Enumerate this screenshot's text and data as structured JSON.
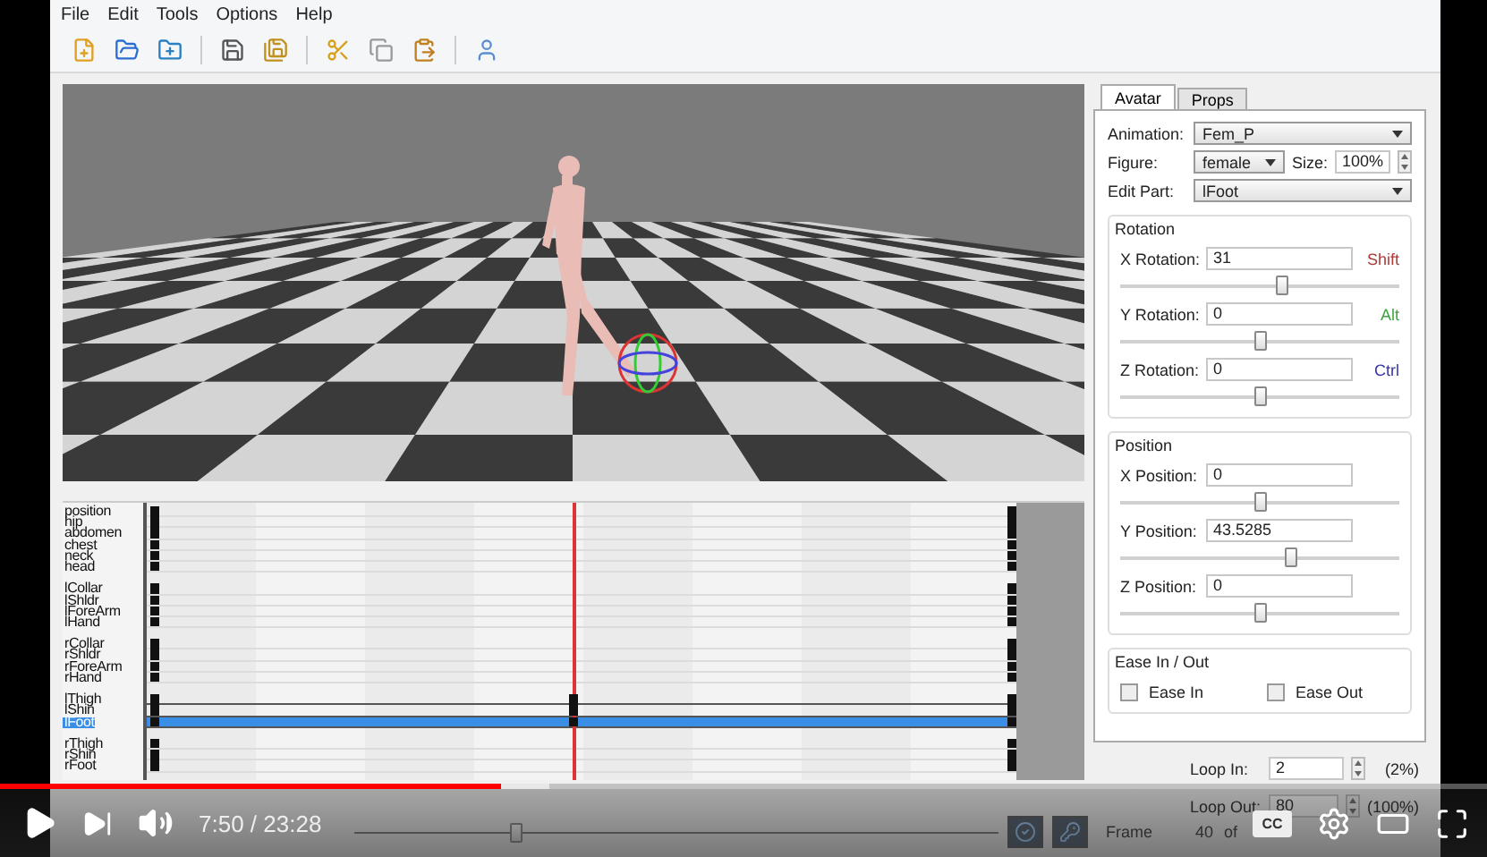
{
  "menu": [
    "File",
    "Edit",
    "Tools",
    "Options",
    "Help"
  ],
  "viewport": {
    "kind": "scene"
  },
  "timeline": {
    "playhead": {
      "level": 0.49
    },
    "groups": [
      {
        "tracks": [
          {
            "name": "position",
            "selected": false,
            "keyed": false
          },
          {
            "name": "hip",
            "selected": false,
            "keyed": false
          },
          {
            "name": "abdomen",
            "selected": false,
            "keyed": false
          },
          {
            "name": "chest",
            "selected": false,
            "keyed": false
          },
          {
            "name": "neck",
            "selected": false,
            "keyed": false
          },
          {
            "name": "head",
            "selected": false,
            "keyed": false
          }
        ]
      },
      {
        "tracks": [
          {
            "name": "lCollar",
            "selected": false,
            "keyed": false
          },
          {
            "name": "lShldr",
            "selected": false,
            "keyed": false
          },
          {
            "name": "lForeArm",
            "selected": false,
            "keyed": false
          },
          {
            "name": "lHand",
            "selected": false,
            "keyed": false
          }
        ]
      },
      {
        "tracks": [
          {
            "name": "rCollar",
            "selected": false,
            "keyed": false
          },
          {
            "name": "rShldr",
            "selected": false,
            "keyed": false
          },
          {
            "name": "rForeArm",
            "selected": false,
            "keyed": false
          },
          {
            "name": "rHand",
            "selected": false,
            "keyed": false
          }
        ]
      },
      {
        "tracks": [
          {
            "name": "lThigh",
            "selected": false,
            "keyed": true
          },
          {
            "name": "lShin",
            "selected": false,
            "keyed": true
          },
          {
            "name": "lFoot",
            "selected": true,
            "keyed": true
          }
        ]
      },
      {
        "tracks": [
          {
            "name": "rThigh",
            "selected": false,
            "keyed": false
          },
          {
            "name": "rShin",
            "selected": false,
            "keyed": false
          },
          {
            "name": "rFoot",
            "selected": false,
            "keyed": false
          }
        ]
      }
    ]
  },
  "tabs": [
    {
      "label": "Avatar",
      "selected": true
    },
    {
      "label": "Props",
      "selected": false
    }
  ],
  "animation": {
    "label": "Animation:",
    "value": "Fem_P"
  },
  "figure": {
    "label": "Figure:",
    "value": "female",
    "size_label": "Size:",
    "size": "100%"
  },
  "edit_part": {
    "label": "Edit Part:",
    "value": "lFoot"
  },
  "rotation": {
    "title": "Rotation",
    "items": [
      {
        "label": "X Rotation:",
        "value": "31",
        "key": "Shift",
        "color": "#b03a3a",
        "level": 0.58
      },
      {
        "label": "Y Rotation:",
        "value": "0",
        "key": "Alt",
        "color": "#3fa33f",
        "level": 0.5
      },
      {
        "label": "Z Rotation:",
        "value": "0",
        "key": "Ctrl",
        "color": "#3535a8",
        "level": 0.5
      }
    ]
  },
  "position": {
    "title": "Position",
    "items": [
      {
        "label": "X Position:",
        "value": "0",
        "level": 0.5
      },
      {
        "label": "Y Position:",
        "value": "43.5285",
        "level": 0.61
      },
      {
        "label": "Z Position:",
        "value": "0",
        "level": 0.5
      }
    ]
  },
  "ease": {
    "title": "Ease In / Out",
    "items": [
      {
        "label": "Ease In",
        "checked": false
      },
      {
        "label": "Ease Out",
        "checked": false
      }
    ]
  },
  "loop": [
    {
      "label": "Loop In:",
      "value": "2",
      "percent": "(2%)"
    },
    {
      "label": "Loop Out:",
      "value": "80",
      "percent": "(100%)"
    }
  ],
  "frame": {
    "label": "Frame",
    "value": "40",
    "of": "of",
    "level": 0.25
  },
  "player": {
    "time": "7:50 / 23:28",
    "cc": "CC",
    "progress": {
      "level": 0.337
    },
    "buffered": {
      "level": 0.37
    }
  }
}
